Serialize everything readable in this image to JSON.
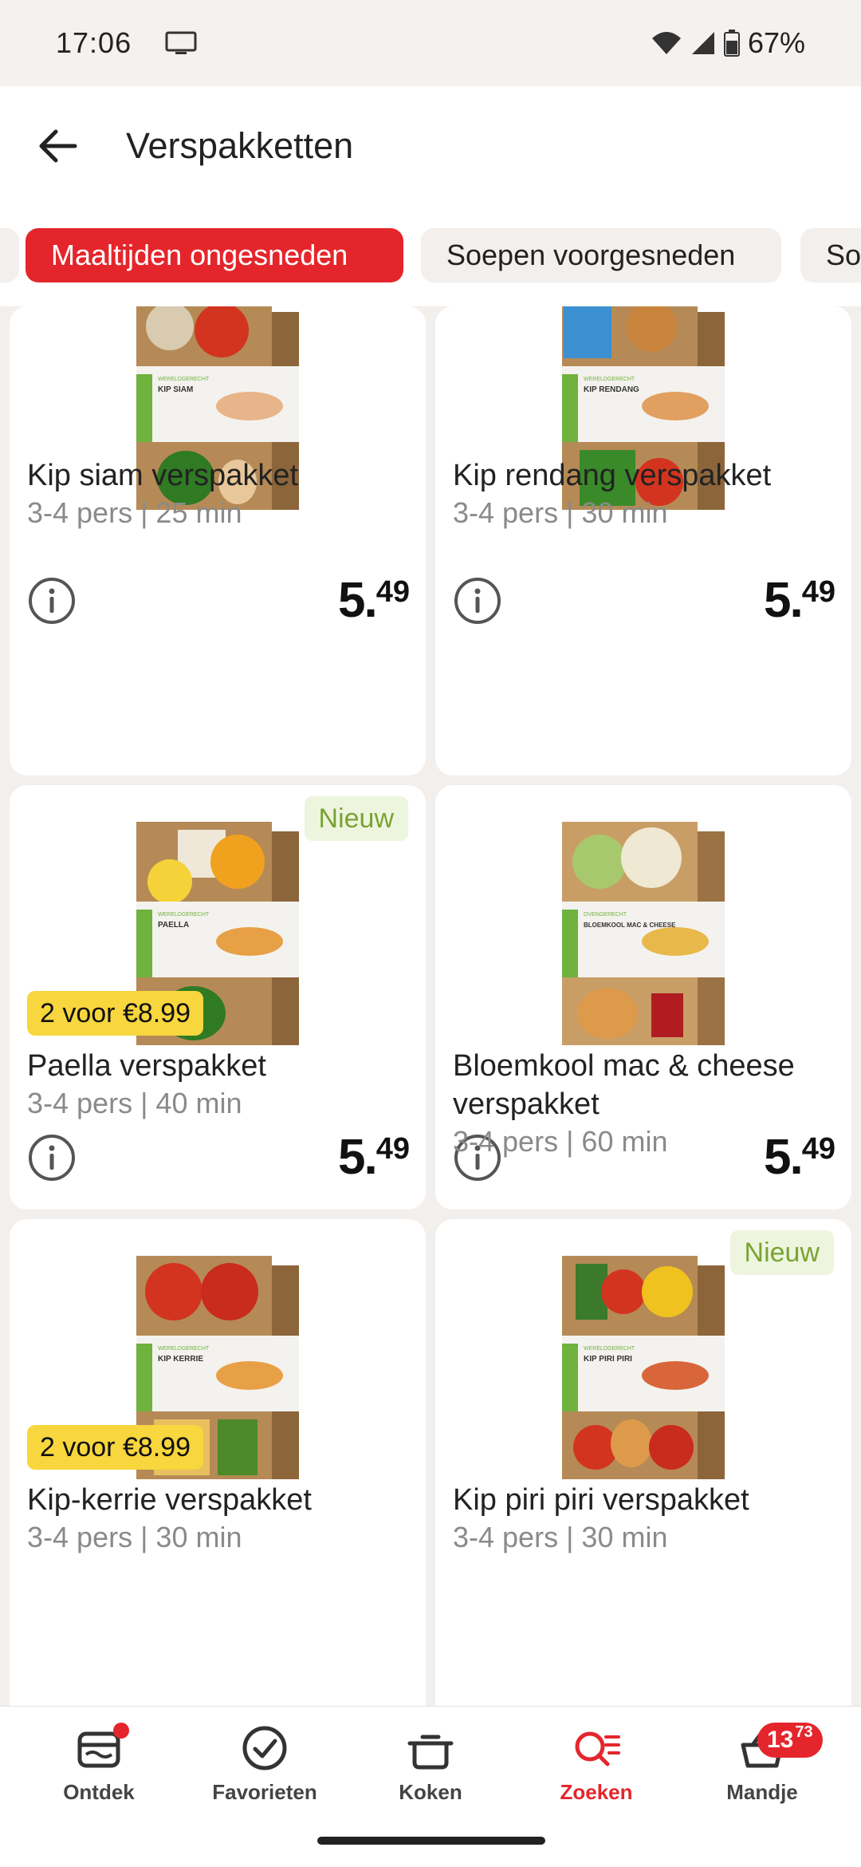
{
  "status": {
    "time": "17:06",
    "battery": "67%"
  },
  "appbar": {
    "title": "Verspakketten"
  },
  "chips": [
    {
      "label": "Maaltijden ongesneden",
      "active": true
    },
    {
      "label": "Soepen voorgesneden",
      "active": false
    },
    {
      "label": "So",
      "active": false
    }
  ],
  "products": [
    {
      "name": "Kip siam verspakket",
      "meta": "3-4 pers | 25 min",
      "price_euros": "5",
      "price_cents": "49",
      "box_label": "KIP SIAM",
      "box_header": "WERELDGERECHT"
    },
    {
      "name": "Kip rendang verspakket",
      "meta": "3-4 pers | 30 min",
      "price_euros": "5",
      "price_cents": "49",
      "box_label": "KIP RENDANG",
      "box_header": "WERELDGERECHT"
    },
    {
      "name": "Paella verspakket",
      "meta": "3-4 pers | 40 min",
      "price_euros": "5",
      "price_cents": "49",
      "badge": "Nieuw",
      "promo": "2 voor €8.99",
      "box_label": "PAELLA",
      "box_header": "WERELDGERECHT"
    },
    {
      "name": "Bloemkool mac & cheese verspakket",
      "meta": "3-4 pers | 60 min",
      "price_euros": "5",
      "price_cents": "49",
      "box_label": "BLOEMKOOL MAC & CHEESE",
      "box_header": "OVENGERECHT"
    },
    {
      "name": "Kip-kerrie verspakket",
      "meta": "3-4 pers | 30 min",
      "promo": "2 voor €8.99",
      "box_label": "KIP KERRIE",
      "box_header": "WERELDGERECHT"
    },
    {
      "name": "Kip piri piri verspakket",
      "meta": "3-4 pers | 30 min",
      "badge": "Nieuw",
      "box_label": "KIP PIRI PIRI",
      "box_header": "WERELDGERECHT"
    }
  ],
  "nav": [
    {
      "label": "Ontdek",
      "icon": "ontdek-icon"
    },
    {
      "label": "Favorieten",
      "icon": "check-circle-icon"
    },
    {
      "label": "Koken",
      "icon": "pot-icon"
    },
    {
      "label": "Zoeken",
      "icon": "search-list-icon",
      "active": true
    },
    {
      "label": "Mandje",
      "icon": "basket-icon"
    }
  ],
  "cart": {
    "euros": "13",
    "cents": "73"
  },
  "colors": {
    "accent": "#e4262c",
    "promo": "#f7d63e",
    "new_bg": "#eef5df",
    "new_fg": "#79a332"
  }
}
